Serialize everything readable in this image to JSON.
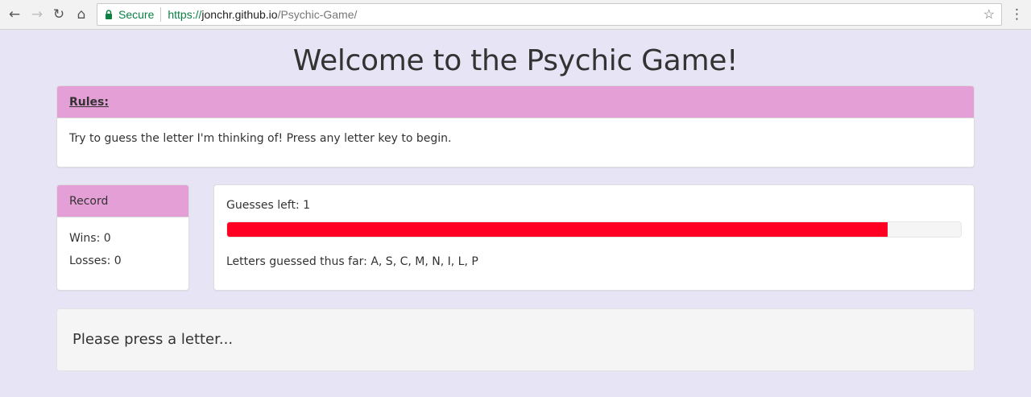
{
  "browser": {
    "secure_label": "Secure",
    "url_scheme": "https://",
    "url_host": "jonchr.github.io",
    "url_path": "/Psychic-Game/"
  },
  "page": {
    "title": "Welcome to the Psychic Game!"
  },
  "rules": {
    "heading": "Rules:",
    "text": "Try to guess the letter I'm thinking of! Press any letter key to begin."
  },
  "record": {
    "heading": "Record",
    "wins": "Wins: 0",
    "losses": "Losses: 0"
  },
  "stats": {
    "guesses_left": "Guesses left: 1",
    "progress_fraction": 0.9,
    "letters_guessed": "Letters guessed thus far: A, S, C, M, N, I, L, P"
  },
  "prompt": {
    "message": "Please press a letter..."
  },
  "colors": {
    "page_background": "#e6e4f5",
    "panel_heading": "#e39fd6",
    "progress_bar": "#ff0022",
    "secure_green": "#0b8043"
  }
}
